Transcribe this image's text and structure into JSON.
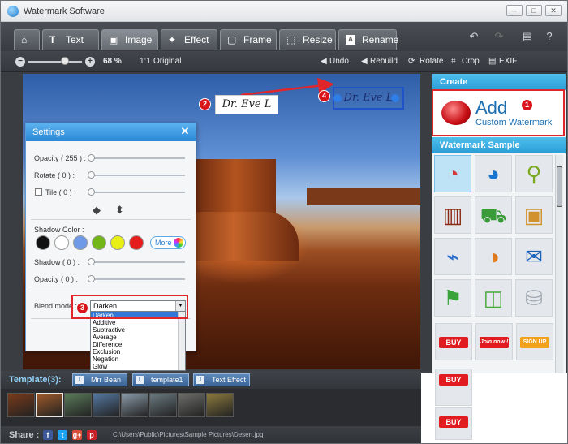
{
  "window": {
    "title": "Watermark Software"
  },
  "window_buttons": [
    "–",
    "□",
    "✕"
  ],
  "tabs": [
    {
      "label": "",
      "icon": "home-icon",
      "glyph": "⌂"
    },
    {
      "label": "Text",
      "icon": "text-icon",
      "glyph": "T"
    },
    {
      "label": "Image",
      "icon": "image-icon",
      "glyph": "▣"
    },
    {
      "label": "Effect",
      "icon": "magic-wand-icon",
      "glyph": "✦"
    },
    {
      "label": "Frame",
      "icon": "frame-icon",
      "glyph": "▢"
    },
    {
      "label": "Resize",
      "icon": "resize-icon",
      "glyph": "⬚"
    },
    {
      "label": "Rename",
      "icon": "rename-icon",
      "glyph": "A"
    }
  ],
  "top_actions": [
    {
      "name": "undo-arrow-icon",
      "glyph": "↶"
    },
    {
      "name": "redo-arrow-icon",
      "glyph": "↷"
    },
    {
      "name": "chat-icon",
      "glyph": "▤"
    },
    {
      "name": "help-icon",
      "glyph": "?"
    }
  ],
  "toolbar": {
    "zoom_percent": "68 %",
    "zoom_level": 0.68,
    "original_label": "Original",
    "undo_label": "Undo",
    "rebuild_label": "Rebuild",
    "rotate_label": "Rotate",
    "crop_label": "Crop",
    "exif_label": "EXIF"
  },
  "canvas": {
    "watermark_text_1": "Dr. Eve L",
    "watermark_text_2": "Dr. Eve L"
  },
  "badges": [
    "1",
    "2",
    "3",
    "4"
  ],
  "settings": {
    "title": "Settings",
    "close_glyph": "✕",
    "opacity_label": "Opacity ( 255 ) :",
    "rotate_label": "Rotate ( 0 ) :",
    "tile_label": "Tile ( 0 ) :",
    "shadow_color_label": "Shadow Color :",
    "more_label": "More",
    "shadow_label": "Shadow ( 0 ) :",
    "shadow_opacity_label": "Opacity ( 0 ) :",
    "blend_mode_label": "Blend mode :",
    "blend_mode_value": "Darken",
    "shadow_colors": [
      "#111111",
      "#ffffff",
      "#6f9ae8",
      "#72b61a",
      "#e8ef14",
      "#e61d1d"
    ],
    "blend_options": [
      "Darken",
      "Additive",
      "Subtractive",
      "Average",
      "Difference",
      "Exclusion",
      "Negation",
      "Glow"
    ]
  },
  "right_panel": {
    "create_header": "Create",
    "add_big": "Add",
    "add_small": "Custom Watermark",
    "sample_header": "Watermark Sample",
    "samples": [
      {
        "name": "sample-pie-chart-3d",
        "glyph": "◔",
        "color": "#d9383b"
      },
      {
        "name": "sample-pie-chart-blue",
        "glyph": "◕",
        "color": "#1a74c9"
      },
      {
        "name": "sample-hanging-tags",
        "glyph": "⚲",
        "color": "#7aa823"
      },
      {
        "name": "sample-server-rack",
        "glyph": "▥",
        "color": "#8a2a14"
      },
      {
        "name": "sample-shopping-cart",
        "glyph": "⛟",
        "color": "#3a9b3a"
      },
      {
        "name": "sample-package-box",
        "glyph": "▣",
        "color": "#d2912d"
      },
      {
        "name": "sample-blue-tag",
        "glyph": "⌁",
        "color": "#2b6fcf"
      },
      {
        "name": "sample-pie-chart-color",
        "glyph": "◑",
        "color": "#e07a1a"
      },
      {
        "name": "sample-email-envelope",
        "glyph": "✉",
        "color": "#1b5fb8"
      },
      {
        "name": "sample-door-hanger-tags",
        "glyph": "⚑",
        "color": "#3aa33a"
      },
      {
        "name": "sample-shopping-basket",
        "glyph": "◫",
        "color": "#48a83a"
      },
      {
        "name": "sample-database-cylinder",
        "glyph": "⛁",
        "color": "#a0a7b0"
      }
    ],
    "buy_label": "BUY",
    "join_label_1": "Join now !",
    "join_label_2": "SIGN UP"
  },
  "template_bar": {
    "label": "Template(3):",
    "templates": [
      "Mrr Bean",
      "template1",
      "Text Effect ..."
    ],
    "template_icon": "T"
  },
  "thumb_colors": [
    "#7a3a1a",
    "#a05a2a",
    "#5a7a5a",
    "#5577a0",
    "#8a9aa8",
    "#6a7a80",
    "#6d6d6a",
    "#8b7a3d"
  ],
  "share": {
    "label": "Share :",
    "networks": [
      {
        "name": "facebook-icon",
        "glyph": "f",
        "color": "#3b5998"
      },
      {
        "name": "twitter-icon",
        "glyph": "t",
        "color": "#1da1f2"
      },
      {
        "name": "google-plus-icon",
        "glyph": "g+",
        "color": "#dd4b39"
      },
      {
        "name": "pinterest-icon",
        "glyph": "p",
        "color": "#cb2027"
      }
    ],
    "file_path": "C:\\Users\\Public\\Pictures\\Sample Pictures\\Desert.jpg"
  }
}
